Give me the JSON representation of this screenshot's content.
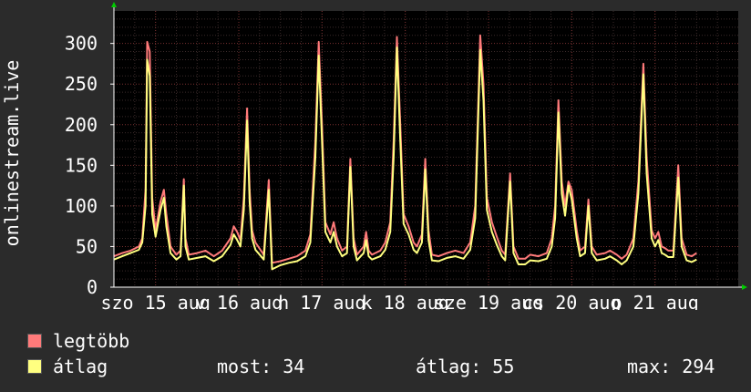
{
  "chart_data": {
    "type": "line",
    "ylabel": "onlinestream.live",
    "ylim": [
      0,
      340
    ],
    "yticks": [
      0,
      50,
      100,
      150,
      200,
      250,
      300
    ],
    "grid": true,
    "x_tick_labels": [
      "szo 15 aug",
      "v 16 aug",
      "h 17 aug",
      "k 18 aug",
      "sze 19 aug",
      "cs 20 aug",
      "p 21 aug"
    ],
    "x_range": [
      0,
      7.5
    ],
    "series": [
      {
        "name": "legtöbb",
        "color": "#ff7a7a",
        "points": [
          [
            0.0,
            38
          ],
          [
            0.1,
            42
          ],
          [
            0.2,
            45
          ],
          [
            0.3,
            50
          ],
          [
            0.34,
            60
          ],
          [
            0.38,
            120
          ],
          [
            0.4,
            302
          ],
          [
            0.43,
            290
          ],
          [
            0.46,
            110
          ],
          [
            0.5,
            70
          ],
          [
            0.56,
            105
          ],
          [
            0.6,
            120
          ],
          [
            0.63,
            90
          ],
          [
            0.68,
            50
          ],
          [
            0.75,
            40
          ],
          [
            0.8,
            45
          ],
          [
            0.84,
            133
          ],
          [
            0.86,
            60
          ],
          [
            0.9,
            40
          ],
          [
            1.0,
            42
          ],
          [
            1.1,
            45
          ],
          [
            1.2,
            38
          ],
          [
            1.3,
            45
          ],
          [
            1.4,
            60
          ],
          [
            1.44,
            75
          ],
          [
            1.48,
            68
          ],
          [
            1.52,
            58
          ],
          [
            1.56,
            110
          ],
          [
            1.6,
            220
          ],
          [
            1.63,
            120
          ],
          [
            1.66,
            70
          ],
          [
            1.7,
            55
          ],
          [
            1.8,
            40
          ],
          [
            1.86,
            132
          ],
          [
            1.9,
            30
          ],
          [
            2.0,
            32
          ],
          [
            2.1,
            35
          ],
          [
            2.2,
            38
          ],
          [
            2.3,
            45
          ],
          [
            2.36,
            65
          ],
          [
            2.42,
            180
          ],
          [
            2.46,
            302
          ],
          [
            2.5,
            200
          ],
          [
            2.54,
            80
          ],
          [
            2.6,
            65
          ],
          [
            2.64,
            80
          ],
          [
            2.68,
            60
          ],
          [
            2.74,
            45
          ],
          [
            2.8,
            50
          ],
          [
            2.84,
            158
          ],
          [
            2.88,
            60
          ],
          [
            2.92,
            40
          ],
          [
            3.0,
            50
          ],
          [
            3.03,
            68
          ],
          [
            3.06,
            45
          ],
          [
            3.1,
            40
          ],
          [
            3.2,
            45
          ],
          [
            3.26,
            55
          ],
          [
            3.32,
            80
          ],
          [
            3.36,
            180
          ],
          [
            3.4,
            308
          ],
          [
            3.44,
            200
          ],
          [
            3.48,
            90
          ],
          [
            3.54,
            75
          ],
          [
            3.6,
            55
          ],
          [
            3.64,
            50
          ],
          [
            3.7,
            65
          ],
          [
            3.74,
            158
          ],
          [
            3.78,
            70
          ],
          [
            3.82,
            40
          ],
          [
            3.9,
            38
          ],
          [
            4.0,
            42
          ],
          [
            4.1,
            45
          ],
          [
            4.2,
            42
          ],
          [
            4.28,
            55
          ],
          [
            4.34,
            100
          ],
          [
            4.4,
            310
          ],
          [
            4.44,
            250
          ],
          [
            4.48,
            110
          ],
          [
            4.54,
            80
          ],
          [
            4.6,
            62
          ],
          [
            4.66,
            45
          ],
          [
            4.7,
            40
          ],
          [
            4.76,
            140
          ],
          [
            4.8,
            50
          ],
          [
            4.86,
            35
          ],
          [
            4.94,
            35
          ],
          [
            5.0,
            40
          ],
          [
            5.1,
            38
          ],
          [
            5.2,
            42
          ],
          [
            5.26,
            60
          ],
          [
            5.3,
            100
          ],
          [
            5.34,
            230
          ],
          [
            5.38,
            130
          ],
          [
            5.42,
            100
          ],
          [
            5.46,
            130
          ],
          [
            5.5,
            120
          ],
          [
            5.56,
            70
          ],
          [
            5.6,
            45
          ],
          [
            5.66,
            50
          ],
          [
            5.7,
            108
          ],
          [
            5.74,
            50
          ],
          [
            5.8,
            40
          ],
          [
            5.9,
            42
          ],
          [
            5.96,
            45
          ],
          [
            6.04,
            40
          ],
          [
            6.1,
            35
          ],
          [
            6.16,
            40
          ],
          [
            6.24,
            60
          ],
          [
            6.3,
            130
          ],
          [
            6.36,
            275
          ],
          [
            6.4,
            160
          ],
          [
            6.46,
            70
          ],
          [
            6.5,
            60
          ],
          [
            6.54,
            68
          ],
          [
            6.58,
            50
          ],
          [
            6.62,
            48
          ],
          [
            6.66,
            45
          ],
          [
            6.72,
            45
          ],
          [
            6.78,
            150
          ],
          [
            6.82,
            60
          ],
          [
            6.88,
            40
          ],
          [
            6.94,
            38
          ],
          [
            7.0,
            42
          ]
        ]
      },
      {
        "name": "átlag",
        "color": "#ffff80",
        "points": [
          [
            0.0,
            34
          ],
          [
            0.1,
            38
          ],
          [
            0.2,
            42
          ],
          [
            0.3,
            46
          ],
          [
            0.34,
            55
          ],
          [
            0.38,
            100
          ],
          [
            0.4,
            280
          ],
          [
            0.43,
            260
          ],
          [
            0.46,
            90
          ],
          [
            0.5,
            62
          ],
          [
            0.56,
            95
          ],
          [
            0.6,
            110
          ],
          [
            0.63,
            75
          ],
          [
            0.68,
            42
          ],
          [
            0.75,
            34
          ],
          [
            0.8,
            38
          ],
          [
            0.84,
            125
          ],
          [
            0.86,
            50
          ],
          [
            0.9,
            34
          ],
          [
            1.0,
            36
          ],
          [
            1.1,
            38
          ],
          [
            1.2,
            32
          ],
          [
            1.3,
            38
          ],
          [
            1.4,
            52
          ],
          [
            1.44,
            65
          ],
          [
            1.48,
            58
          ],
          [
            1.52,
            50
          ],
          [
            1.56,
            95
          ],
          [
            1.6,
            205
          ],
          [
            1.63,
            105
          ],
          [
            1.66,
            60
          ],
          [
            1.7,
            46
          ],
          [
            1.8,
            34
          ],
          [
            1.86,
            120
          ],
          [
            1.9,
            22
          ],
          [
            2.0,
            27
          ],
          [
            2.1,
            30
          ],
          [
            2.2,
            32
          ],
          [
            2.3,
            38
          ],
          [
            2.36,
            55
          ],
          [
            2.42,
            160
          ],
          [
            2.46,
            285
          ],
          [
            2.5,
            180
          ],
          [
            2.54,
            68
          ],
          [
            2.6,
            55
          ],
          [
            2.64,
            68
          ],
          [
            2.68,
            50
          ],
          [
            2.74,
            38
          ],
          [
            2.8,
            42
          ],
          [
            2.84,
            148
          ],
          [
            2.88,
            50
          ],
          [
            2.92,
            33
          ],
          [
            3.0,
            42
          ],
          [
            3.03,
            58
          ],
          [
            3.06,
            38
          ],
          [
            3.1,
            34
          ],
          [
            3.2,
            38
          ],
          [
            3.26,
            46
          ],
          [
            3.32,
            68
          ],
          [
            3.36,
            160
          ],
          [
            3.4,
            295
          ],
          [
            3.44,
            180
          ],
          [
            3.48,
            78
          ],
          [
            3.54,
            65
          ],
          [
            3.6,
            46
          ],
          [
            3.64,
            42
          ],
          [
            3.7,
            55
          ],
          [
            3.74,
            145
          ],
          [
            3.78,
            58
          ],
          [
            3.82,
            33
          ],
          [
            3.9,
            32
          ],
          [
            4.0,
            36
          ],
          [
            4.1,
            38
          ],
          [
            4.2,
            35
          ],
          [
            4.28,
            46
          ],
          [
            4.34,
            85
          ],
          [
            4.4,
            292
          ],
          [
            4.44,
            230
          ],
          [
            4.48,
            95
          ],
          [
            4.54,
            68
          ],
          [
            4.6,
            52
          ],
          [
            4.66,
            38
          ],
          [
            4.7,
            33
          ],
          [
            4.76,
            130
          ],
          [
            4.8,
            42
          ],
          [
            4.86,
            28
          ],
          [
            4.94,
            28
          ],
          [
            5.0,
            33
          ],
          [
            5.1,
            32
          ],
          [
            5.2,
            35
          ],
          [
            5.26,
            50
          ],
          [
            5.3,
            85
          ],
          [
            5.34,
            215
          ],
          [
            5.38,
            115
          ],
          [
            5.42,
            88
          ],
          [
            5.46,
            125
          ],
          [
            5.5,
            108
          ],
          [
            5.56,
            60
          ],
          [
            5.6,
            38
          ],
          [
            5.66,
            42
          ],
          [
            5.7,
            100
          ],
          [
            5.74,
            42
          ],
          [
            5.8,
            33
          ],
          [
            5.9,
            35
          ],
          [
            5.96,
            38
          ],
          [
            6.04,
            33
          ],
          [
            6.1,
            28
          ],
          [
            6.16,
            33
          ],
          [
            6.24,
            50
          ],
          [
            6.3,
            115
          ],
          [
            6.36,
            262
          ],
          [
            6.4,
            140
          ],
          [
            6.46,
            60
          ],
          [
            6.5,
            50
          ],
          [
            6.54,
            58
          ],
          [
            6.58,
            42
          ],
          [
            6.62,
            40
          ],
          [
            6.66,
            37
          ],
          [
            6.72,
            37
          ],
          [
            6.78,
            135
          ],
          [
            6.82,
            50
          ],
          [
            6.88,
            33
          ],
          [
            6.94,
            31
          ],
          [
            7.0,
            34
          ]
        ]
      }
    ]
  },
  "legend": {
    "items": [
      {
        "label": "legtöbb",
        "color": "#ff7a7a"
      },
      {
        "label": "átlag",
        "color": "#ffff80"
      }
    ]
  },
  "stats": {
    "now": "most: 34",
    "avg": "átlag: 55",
    "max": "max: 294"
  }
}
